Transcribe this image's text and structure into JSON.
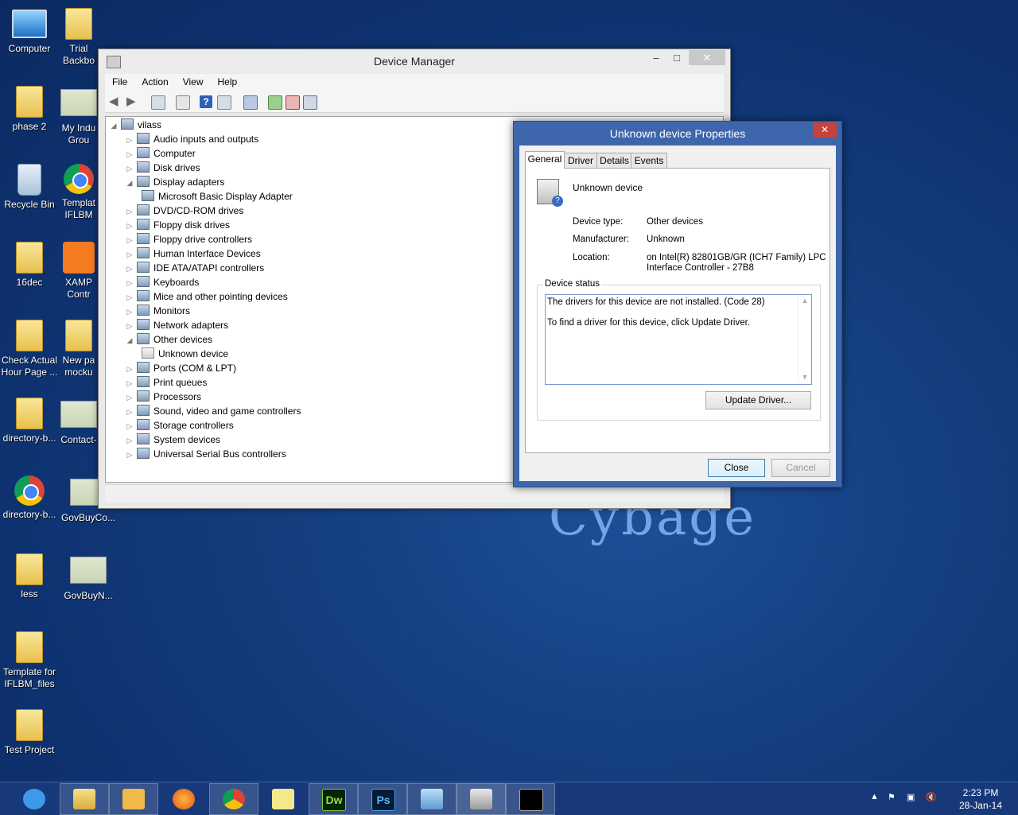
{
  "desktop": {
    "icons": [
      {
        "label": "Computer"
      },
      {
        "label": "Trial\nBackbo"
      },
      {
        "label": "phase 2"
      },
      {
        "label": "My Indu\nGrou"
      },
      {
        "label": "Recycle Bin"
      },
      {
        "label": "Templat\nIFLBM"
      },
      {
        "label": "16dec"
      },
      {
        "label": "XAMP\nContr"
      },
      {
        "label": "Check Actual\nHour Page ..."
      },
      {
        "label": "New pa\nmocku"
      },
      {
        "label": "directory-b..."
      },
      {
        "label": "Contact-"
      },
      {
        "label": "directory-b..."
      },
      {
        "label": "GovBuyCo..."
      },
      {
        "label": "less"
      },
      {
        "label": "GovBuyN..."
      },
      {
        "label": "Template for\nIFLBM_files"
      },
      {
        "label": "Test Project"
      }
    ],
    "brand": "Cybage"
  },
  "device_manager": {
    "title": "Device Manager",
    "menu": [
      "File",
      "Action",
      "View",
      "Help"
    ],
    "root": "vilass",
    "nodes": [
      {
        "label": "Audio inputs and outputs",
        "expanded": false
      },
      {
        "label": "Computer",
        "expanded": false
      },
      {
        "label": "Disk drives",
        "expanded": false
      },
      {
        "label": "Display adapters",
        "expanded": true
      },
      {
        "label": "Microsoft Basic Display Adapter",
        "child": true
      },
      {
        "label": "DVD/CD-ROM drives",
        "expanded": false
      },
      {
        "label": "Floppy disk drives",
        "expanded": false
      },
      {
        "label": "Floppy drive controllers",
        "expanded": false
      },
      {
        "label": "Human Interface Devices",
        "expanded": false
      },
      {
        "label": "IDE ATA/ATAPI controllers",
        "expanded": false
      },
      {
        "label": "Keyboards",
        "expanded": false
      },
      {
        "label": "Mice and other pointing devices",
        "expanded": false
      },
      {
        "label": "Monitors",
        "expanded": false
      },
      {
        "label": "Network adapters",
        "expanded": false
      },
      {
        "label": "Other devices",
        "expanded": true
      },
      {
        "label": "Unknown device",
        "child": true,
        "warning": true
      },
      {
        "label": "Ports (COM & LPT)",
        "expanded": false
      },
      {
        "label": "Print queues",
        "expanded": false
      },
      {
        "label": "Processors",
        "expanded": false
      },
      {
        "label": "Sound, video and game controllers",
        "expanded": false
      },
      {
        "label": "Storage controllers",
        "expanded": false
      },
      {
        "label": "System devices",
        "expanded": false
      },
      {
        "label": "Universal Serial Bus controllers",
        "expanded": false
      }
    ]
  },
  "properties": {
    "title": "Unknown device Properties",
    "close_glyph": "✕",
    "tabs": [
      "General",
      "Driver",
      "Details",
      "Events"
    ],
    "device_name": "Unknown device",
    "device_type_label": "Device type:",
    "device_type": "Other devices",
    "manufacturer_label": "Manufacturer:",
    "manufacturer": "Unknown",
    "location_label": "Location:",
    "location_line1": "on Intel(R) 82801GB/GR (ICH7 Family) LPC",
    "location_line2": "Interface Controller - 27B8",
    "status_group": "Device status",
    "status_line1": "The drivers for this device are not installed. (Code 28)",
    "status_line2": "To find a driver for this device, click Update Driver.",
    "update_button": "Update Driver...",
    "close_button": "Close",
    "cancel_button": "Cancel"
  },
  "taskbar": {
    "time": "2:23 PM",
    "date": "28-Jan-14",
    "apps": [
      "internet-explorer-icon",
      "file-explorer-icon",
      "outlook-icon",
      "firefox-icon",
      "chrome-icon",
      "sticky-notes-icon",
      "dreamweaver-icon",
      "photoshop-icon",
      "control-panel-icon",
      "device-manager-icon",
      "command-prompt-icon"
    ],
    "dw_label": "Dw",
    "ps_label": "Ps"
  }
}
